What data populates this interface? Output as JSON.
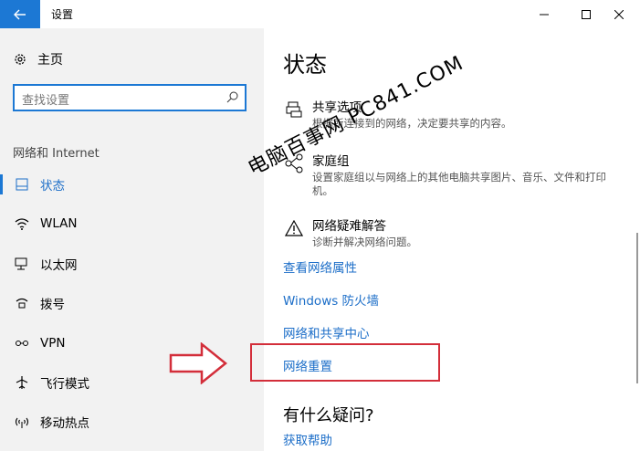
{
  "window": {
    "title": "设置",
    "back_icon": "arrow-left-icon"
  },
  "sidebar": {
    "home_label": "主页",
    "search_placeholder": "查找设置",
    "section_title": "网络和 Internet",
    "items": [
      {
        "label": "状态",
        "icon": "status-icon",
        "active": true
      },
      {
        "label": "WLAN",
        "icon": "wifi-icon"
      },
      {
        "label": "以太网",
        "icon": "ethernet-icon"
      },
      {
        "label": "拨号",
        "icon": "dialup-icon"
      },
      {
        "label": "VPN",
        "icon": "vpn-icon"
      },
      {
        "label": "飞行模式",
        "icon": "airplane-icon"
      },
      {
        "label": "移动热点",
        "icon": "hotspot-icon"
      }
    ]
  },
  "main": {
    "heading": "状态",
    "options": [
      {
        "title": "共享选项",
        "desc": "根据所连接到的网络，决定要共享的内容。",
        "icon": "printer-share-icon"
      },
      {
        "title": "家庭组",
        "desc": "设置家庭组以与网络上的其他电脑共享图片、音乐、文件和打印机。",
        "icon": "homegroup-icon"
      },
      {
        "title": "网络疑难解答",
        "desc": "诊断并解决网络问题。",
        "icon": "warning-icon"
      }
    ],
    "links": [
      "查看网络属性",
      "Windows 防火墙",
      "网络和共享中心",
      "网络重置"
    ],
    "help_heading": "有什么疑问?",
    "help_link": "获取帮助"
  },
  "watermark": "电脑百事网 PC841.COM",
  "colors": {
    "accent": "#1c78d4",
    "link": "#1c6ec8",
    "highlight": "#d32e3a"
  }
}
